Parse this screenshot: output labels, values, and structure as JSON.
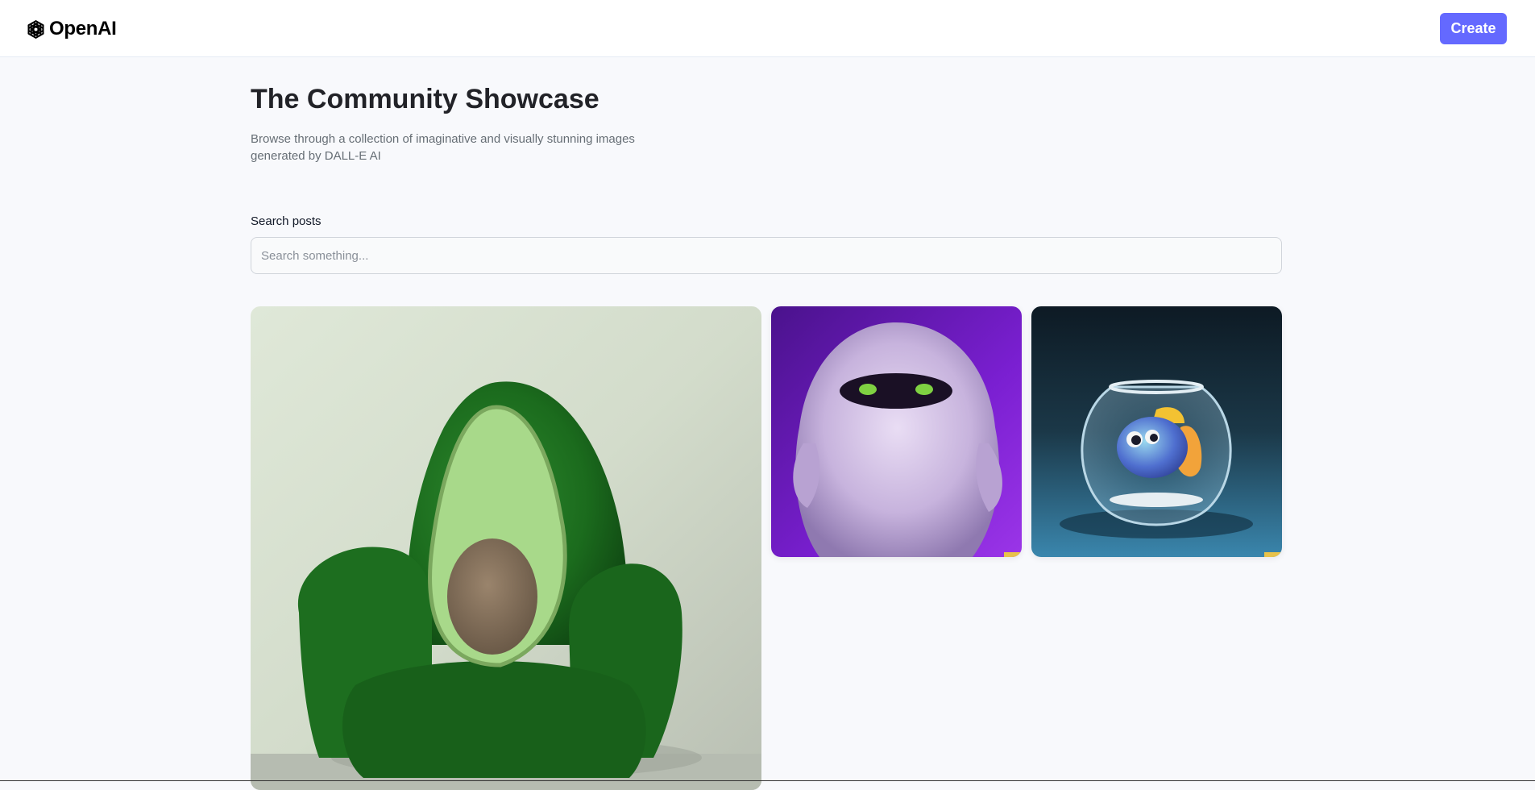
{
  "header": {
    "logo_text": "OpenAI",
    "create_label": "Create"
  },
  "main": {
    "title": "The Community Showcase",
    "subtitle": "Browse through a collection of imaginative and visually stunning images generated by DALL-E AI",
    "search": {
      "label": "Search posts",
      "placeholder": "Search something...",
      "value": ""
    }
  },
  "gallery": {
    "items": [
      {
        "subject": "avocado armchair"
      },
      {
        "subject": "furry purple monster"
      },
      {
        "subject": "fish in fishbowl"
      }
    ]
  },
  "colors": {
    "accent": "#6469ff",
    "page_background": "#f8f9fc",
    "title_text": "#222328",
    "subtitle_text": "#666e75"
  }
}
